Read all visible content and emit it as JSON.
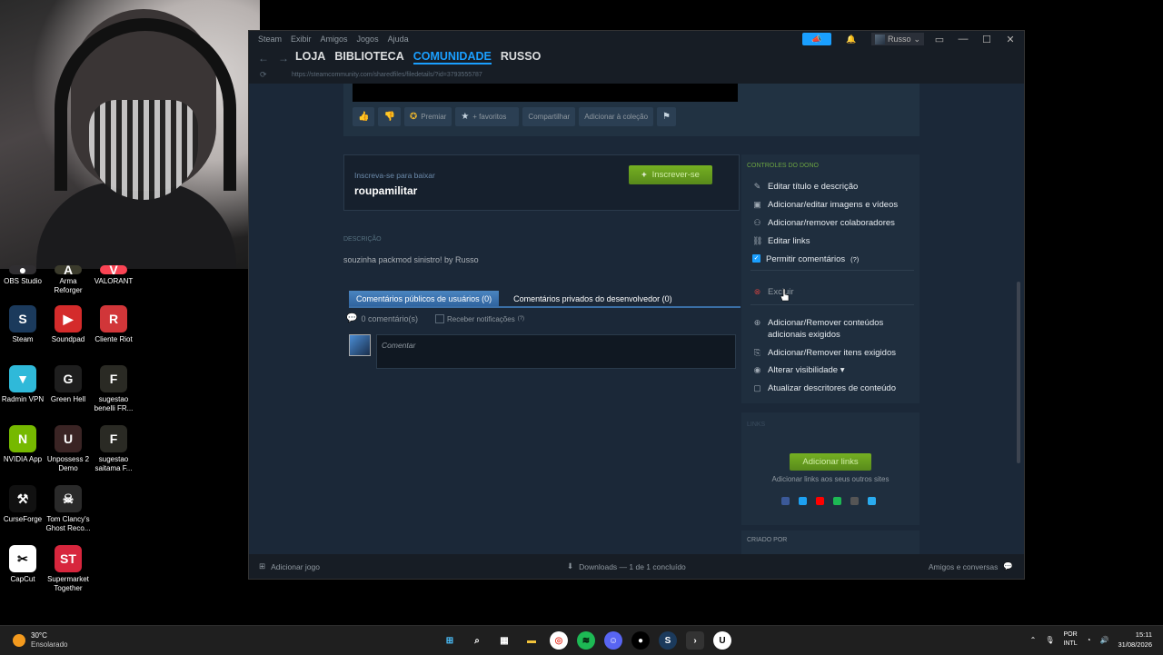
{
  "desktop": {
    "icons": [
      {
        "label": "OBS Studio",
        "color": "#302e31",
        "glyph": "●"
      },
      {
        "label": "Arma Reforger",
        "color": "#3b3b2c",
        "glyph": "A"
      },
      {
        "label": "VALORANT",
        "color": "#fa4454",
        "glyph": "V"
      },
      {
        "label": "Steam",
        "color": "#1b3a5c",
        "glyph": "S"
      },
      {
        "label": "Soundpad",
        "color": "#d42b2b",
        "glyph": "▶"
      },
      {
        "label": "Cliente Riot",
        "color": "#d13639",
        "glyph": "R"
      },
      {
        "label": "Radmin VPN",
        "color": "#2fb9d9",
        "glyph": "▼"
      },
      {
        "label": "Green Hell",
        "color": "#1e1e1e",
        "glyph": "G"
      },
      {
        "label": "sugestao benelli FR...",
        "color": "#2a2a24",
        "glyph": "F"
      },
      {
        "label": "NVIDIA App",
        "color": "#76b900",
        "glyph": "N"
      },
      {
        "label": "Unpossess 2 Demo",
        "color": "#3a2424",
        "glyph": "U"
      },
      {
        "label": "sugestao saitama F...",
        "color": "#2a2a24",
        "glyph": "F"
      },
      {
        "label": "CurseForge",
        "color": "#111111",
        "glyph": "⚒"
      },
      {
        "label": "Tom Clancy's Ghost Reco...",
        "color": "#2a2a2a",
        "glyph": "☠"
      },
      {
        "label": "CapCut",
        "color": "#ffffff",
        "glyph": "✂"
      },
      {
        "label": "Supermarket Together",
        "color": "#d7263d",
        "glyph": "ST"
      }
    ]
  },
  "titlebar": {
    "menu": [
      "Steam",
      "Exibir",
      "Amigos",
      "Jogos",
      "Ajuda"
    ],
    "username": "Russo"
  },
  "nav": {
    "links": [
      "LOJA",
      "BIBLIOTECA",
      "COMUNIDADE",
      "RUSSO"
    ],
    "active_index": 2,
    "url": "https://steamcommunity.com/sharedfiles/filedetails/?id=3793555787"
  },
  "actions": {
    "premiar": "Premiar",
    "favoritos": "+ favoritos",
    "compartilhar": "Compartilhar",
    "colecao": "Adicionar à coleção"
  },
  "subscribe": {
    "small": "Inscreva-se para baixar",
    "title": "roupamilitar",
    "button": "Inscrever-se"
  },
  "description": {
    "label": "DESCRIÇÃO",
    "text": "souzinha packmod sinistro! by Russo"
  },
  "comments": {
    "tab_public": "Comentários públicos de usuários (0)",
    "tab_private": "Comentários privados do desenvolvedor (0)",
    "count": "0 comentário(s)",
    "notify": "Receber notificações",
    "notify_help": "(?)",
    "placeholder": "Comentar"
  },
  "owner": {
    "header": "CONTROLES DO DONO",
    "items": [
      "Editar título e descrição",
      "Adicionar/editar imagens e vídeos",
      "Adicionar/remover colaboradores",
      "Editar links"
    ],
    "allow_comments": "Permitir comentários",
    "allow_help": "(?)",
    "delete": "Excluir",
    "items2": [
      "Adicionar/Remover conteúdos adicionais exigidos",
      "Adicionar/Remover itens exigidos",
      "Alterar visibilidade ▾",
      "Atualizar descritores de conteúdo"
    ]
  },
  "links": {
    "label": "LINKS",
    "button": "Adicionar links",
    "sub": "Adicionar links aos seus outros sites",
    "social_colors": [
      "#3b5998",
      "#1da1f2",
      "#ff0000",
      "#1db954",
      "#555555",
      "#2aabee"
    ]
  },
  "created_by": "CRIADO POR",
  "statusbar": {
    "add_game": "Adicionar jogo",
    "downloads": "Downloads — 1 de 1 concluído",
    "friends": "Amigos e conversas"
  },
  "taskbar": {
    "temp": "30°C",
    "condition": "Ensolarado",
    "lang1": "POR",
    "lang2": "INTL",
    "time": "15:11",
    "date": "31/08/2026"
  }
}
